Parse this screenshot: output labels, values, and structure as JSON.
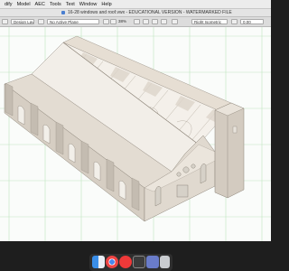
{
  "menubar": {
    "items": [
      "dify",
      "Model",
      "AEC",
      "Tools",
      "Text",
      "Window",
      "Help"
    ]
  },
  "window": {
    "title": "16-28 windows and roof.vwx - EDUCATIONAL VERSION - WATERMARKED FILE"
  },
  "toolbar": {
    "layer_field": "Design Layer-1",
    "class_field": "No Active Plane",
    "zoom": "38%",
    "view_field": "Right Isometric",
    "render_field": "0.00"
  },
  "colors": {
    "canvas_bg": "#fafcfa",
    "grid_line": "#bfe5bf",
    "building_light": "#efe9e1",
    "building_mid": "#d9d1c7",
    "building_dark": "#a8a095",
    "window_glass": "#d8d4cc"
  },
  "dock": {
    "icons": [
      "finder-icon",
      "chrome-icon",
      "vivaldi-icon",
      "vectorworks-icon",
      "app-icon",
      "trash-icon"
    ]
  }
}
